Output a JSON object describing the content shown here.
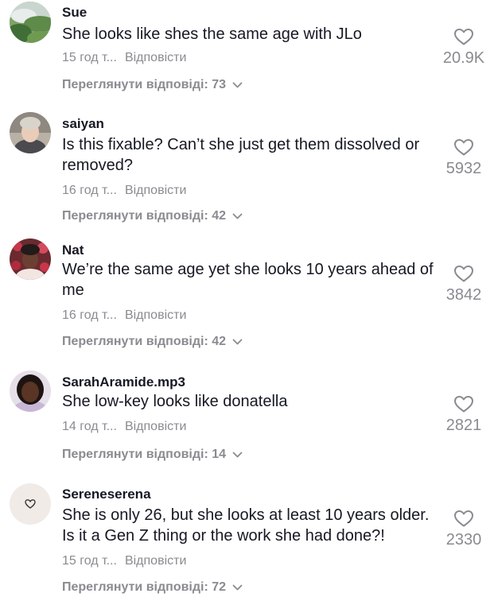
{
  "comments": [
    {
      "username": "Sue",
      "text": "She looks like shes the same age with JLo",
      "time": "15 год т...",
      "reply_label": "Відповісти",
      "view_replies": "Переглянути відповіді: 73",
      "likes": "20.9K",
      "avatar": "landscape-photo"
    },
    {
      "username": "saiyan",
      "text": "Is this fixable? Can’t she just get them dissolved or removed?",
      "time": "16 год т...",
      "reply_label": "Відповісти",
      "view_replies": "Переглянути відповіді: 42",
      "likes": "5932",
      "avatar": "person-photo"
    },
    {
      "username": "Nat",
      "text": "We’re the same age yet she looks 10 years ahead of me",
      "time": "16 год т...",
      "reply_label": "Відповісти",
      "view_replies": "Переглянути відповіді: 42",
      "likes": "3842",
      "avatar": "person-photo"
    },
    {
      "username": "SarahAramide.mp3",
      "text": "She low-key looks like donatella",
      "time": "14 год т...",
      "reply_label": "Відповісти",
      "view_replies": "Переглянути відповіді: 14",
      "likes": "2821",
      "avatar": "person-photo"
    },
    {
      "username": "Sereneserena",
      "text": "She is only 26, but she looks at least 10 years older. Is it a Gen Z thing or the work she had done?!",
      "time": "15 год т...",
      "reply_label": "Відповісти",
      "view_replies": "Переглянути відповіді: 72",
      "likes": "2330",
      "avatar": "heart-drawing"
    }
  ],
  "colors": {
    "text": "#161823",
    "secondary": "#8a8b91",
    "background": "#ffffff"
  }
}
